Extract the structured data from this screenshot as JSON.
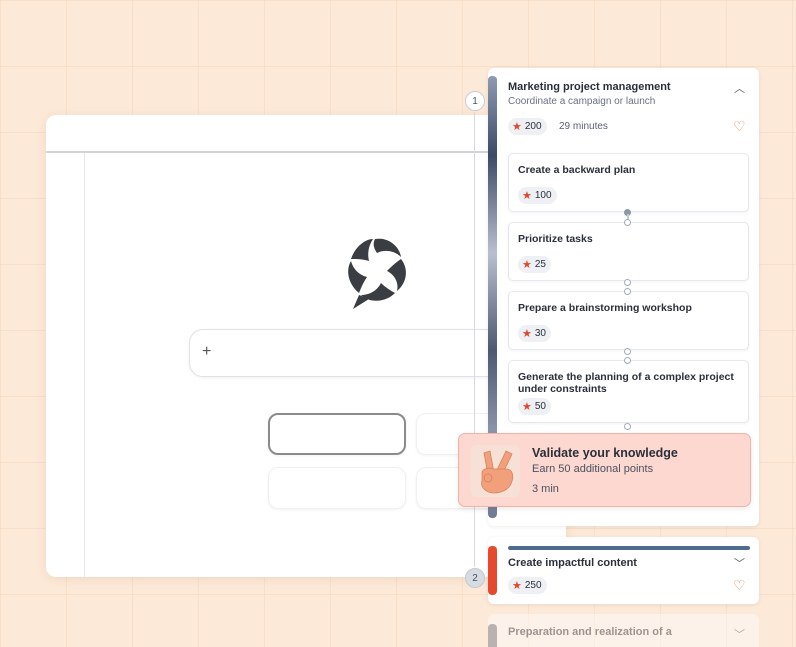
{
  "steps": [
    "1",
    "2"
  ],
  "course": {
    "title": "Marketing project management",
    "subtitle": "Coordinate a campaign or launch",
    "points": "200",
    "duration": "29 minutes",
    "lessons": [
      {
        "title": "Create a backward plan",
        "points": "100"
      },
      {
        "title": "Prioritize tasks",
        "points": "25"
      },
      {
        "title": "Prepare a brainstorming workshop",
        "points": "30"
      },
      {
        "title": "Generate the planning of a complex project under constraints",
        "points": "50"
      }
    ]
  },
  "quiz": {
    "title": "Validate your knowledge",
    "subtitle": "Earn 50 additional points",
    "duration": "3 min"
  },
  "course2": {
    "title": "Create impactful content",
    "points": "250",
    "progress": 1.0
  },
  "course3": {
    "title": "Preparation and realization of a"
  },
  "icons": {
    "star": "star-icon",
    "heart": "heart-icon",
    "chevron_up": "chevron-up-icon",
    "chevron_down": "chevron-down-icon",
    "plus": "plus-icon",
    "logo": "logo-icon"
  },
  "colors": {
    "background": "#fde9d8",
    "accent_red": "#e64a2e",
    "quiz_bg": "#fcd8d1",
    "heart": "#ec7f61",
    "progress": "#4f6b8e"
  }
}
